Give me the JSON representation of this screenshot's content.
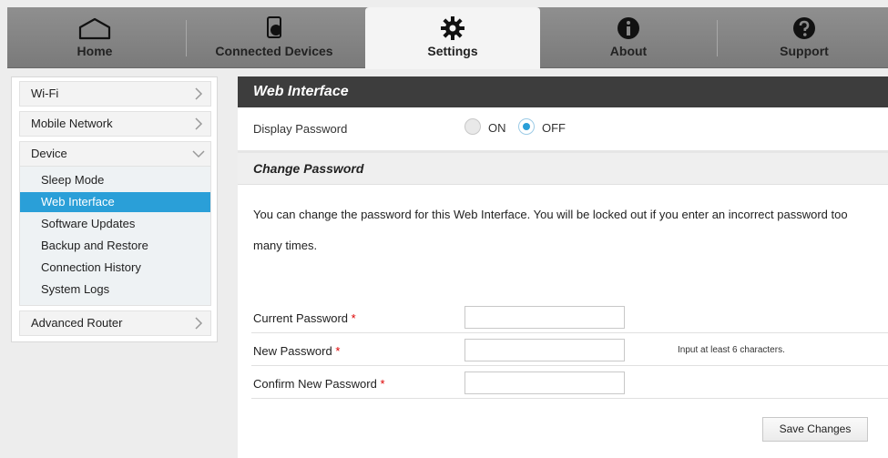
{
  "nav": {
    "tabs": [
      {
        "label": "Home",
        "icon": "home-icon"
      },
      {
        "label": "Connected Devices",
        "icon": "devices-icon"
      },
      {
        "label": "Settings",
        "icon": "gear-icon",
        "active": true
      },
      {
        "label": "About",
        "icon": "info-icon"
      },
      {
        "label": "Support",
        "icon": "help-icon"
      }
    ]
  },
  "sidebar": {
    "items": [
      {
        "label": "Wi-Fi"
      },
      {
        "label": "Mobile Network"
      },
      {
        "label": "Device",
        "expanded": true
      },
      {
        "label": "Advanced Router"
      }
    ],
    "device_sub": [
      {
        "label": "Sleep Mode"
      },
      {
        "label": "Web Interface",
        "active": true
      },
      {
        "label": "Software Updates"
      },
      {
        "label": "Backup and Restore"
      },
      {
        "label": "Connection History"
      },
      {
        "label": "System Logs"
      }
    ]
  },
  "main": {
    "title": "Web Interface",
    "display_password": {
      "label": "Display Password",
      "on_label": "ON",
      "off_label": "OFF",
      "selected": "OFF"
    },
    "change_password": {
      "title": "Change Password",
      "description": "You can change the password for this Web Interface. You will be locked out if you enter an incorrect password too many times.",
      "current_label": "Current Password",
      "new_label": "New Password",
      "confirm_label": "Confirm New Password",
      "required_mark": "*",
      "new_hint": "Input at least 6 characters.",
      "current_value": "",
      "new_value": "",
      "confirm_value": ""
    },
    "save_label": "Save Changes"
  },
  "colors": {
    "accent": "#2a9fd8",
    "header_bg": "#3d3d3d",
    "required": "#dd0000"
  }
}
